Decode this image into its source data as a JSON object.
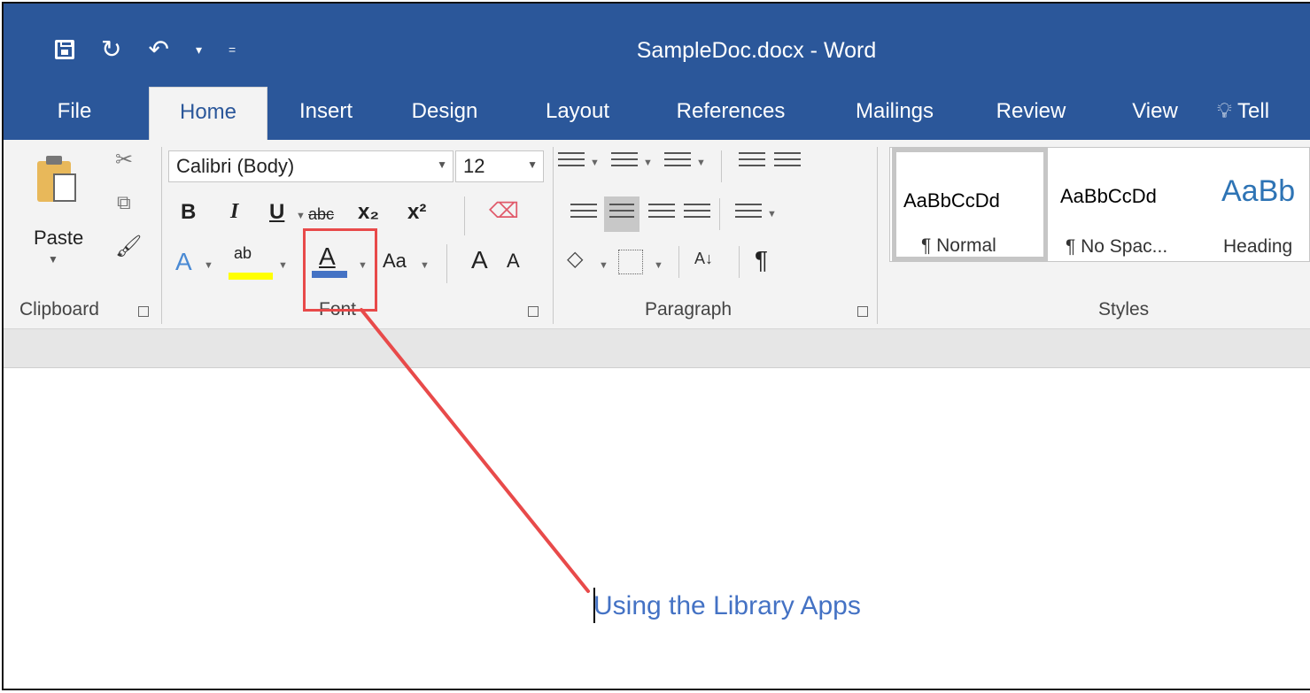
{
  "window": {
    "title": "SampleDoc.docx - Word"
  },
  "quick_access": {
    "more": "▾",
    "customize": "="
  },
  "tabs": [
    {
      "label": "File"
    },
    {
      "label": "Home"
    },
    {
      "label": "Insert"
    },
    {
      "label": "Design"
    },
    {
      "label": "Layout"
    },
    {
      "label": "References"
    },
    {
      "label": "Mailings"
    },
    {
      "label": "Review"
    },
    {
      "label": "View"
    },
    {
      "label": "Tell"
    }
  ],
  "ribbon": {
    "clipboard": {
      "paste_label": "Paste",
      "group_label": "Clipboard"
    },
    "font": {
      "font_name": "Calibri (Body)",
      "font_size": "12",
      "bold": "B",
      "italic": "I",
      "underline": "U",
      "strikethrough": "abc",
      "subscript": "x₂",
      "superscript": "x²",
      "text_effects": "A",
      "highlight": "ab",
      "font_color": "A",
      "change_case": "Aa",
      "grow_font": "A",
      "shrink_font": "A",
      "group_label": "Font"
    },
    "paragraph": {
      "sort": "A↓",
      "pilcrow": "¶",
      "group_label": "Paragraph"
    },
    "styles": {
      "items": [
        {
          "sample": "AaBbCcDd",
          "name": "¶ Normal"
        },
        {
          "sample": "AaBbCcDd",
          "name": "¶ No Spac..."
        },
        {
          "sample": "AaBb",
          "name": "Heading"
        }
      ],
      "group_label": "Styles"
    }
  },
  "document": {
    "text": "Using the Library Apps"
  },
  "colors": {
    "title_bar": "#2b579a",
    "ribbon": "#f3f3f3",
    "heading_text": "#4472c4",
    "highlight_yellow": "#ffff00",
    "font_color_bar": "#4472c4",
    "annotation_red": "#e84a4a"
  }
}
